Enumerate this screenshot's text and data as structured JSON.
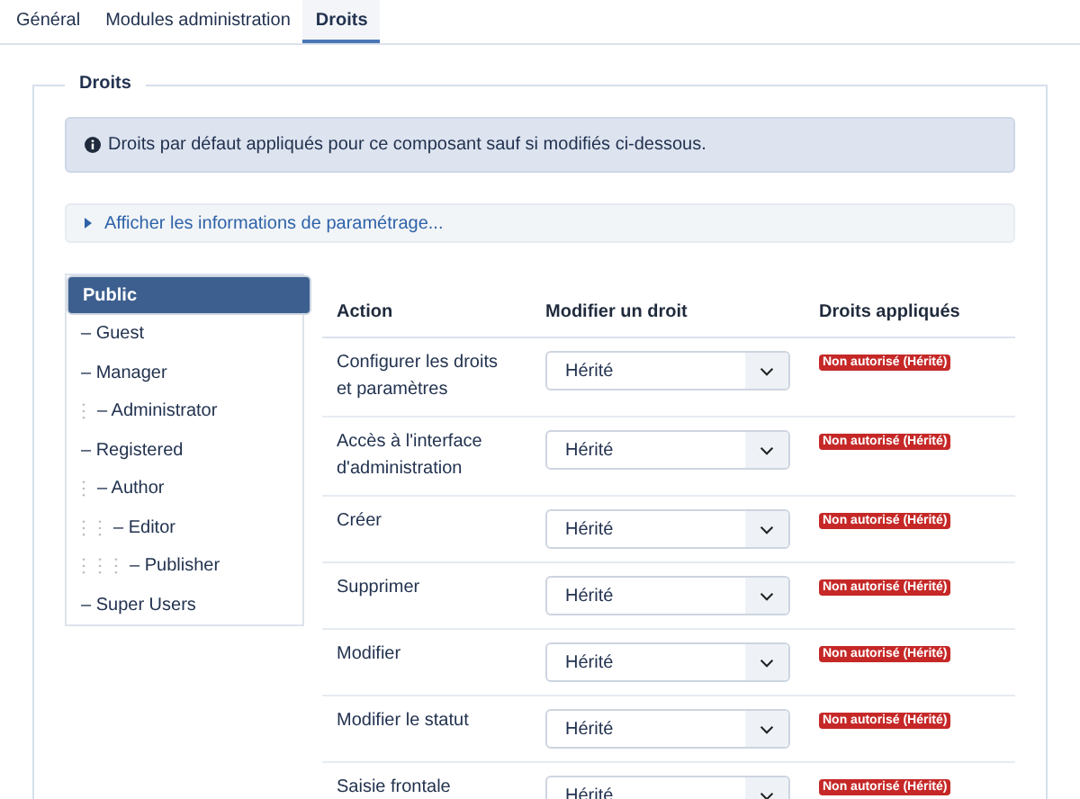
{
  "tabs": [
    {
      "label": "Général",
      "selected": false
    },
    {
      "label": "Modules administration",
      "selected": false
    },
    {
      "label": "Droits",
      "selected": true
    }
  ],
  "fieldset": {
    "legend": "Droits",
    "info": "Droits par défaut appliqués pour ce composant sauf si modifiés ci-dessous.",
    "details": {
      "label": "Afficher les informations de paramétrage...",
      "expanded": false
    },
    "groups": [
      {
        "label": "Public",
        "selected": true,
        "children": [
          {
            "label": "– Guest",
            "selected": false
          },
          {
            "label": "– Manager",
            "selected": false,
            "children": [
              {
                "label": "– Administrator",
                "selected": false
              }
            ]
          },
          {
            "label": "– Registered",
            "selected": false,
            "children": [
              {
                "label": "– Author",
                "selected": false,
                "children": [
                  {
                    "label": "– Editor",
                    "selected": false,
                    "children": [
                      {
                        "label": "– Publisher",
                        "selected": false
                      }
                    ]
                  }
                ]
              }
            ]
          },
          {
            "label": "– Super Users",
            "selected": false
          }
        ]
      }
    ],
    "table": {
      "columns": [
        "Action",
        "Modifier un droit",
        "Droits appliqués"
      ],
      "rows": [
        {
          "action": "Configurer les droits et paramètres",
          "setting": "Hérité",
          "applied": "Non autorisé (Hérité)"
        },
        {
          "action": "Accès à l'interface d'administration",
          "setting": "Hérité",
          "applied": "Non autorisé (Hérité)"
        },
        {
          "action": "Créer",
          "setting": "Hérité",
          "applied": "Non autorisé (Hérité)"
        },
        {
          "action": "Supprimer",
          "setting": "Hérité",
          "applied": "Non autorisé (Hérité)"
        },
        {
          "action": "Modifier",
          "setting": "Hérité",
          "applied": "Non autorisé (Hérité)"
        },
        {
          "action": "Modifier le statut",
          "setting": "Hérité",
          "applied": "Non autorisé (Hérité)"
        },
        {
          "action": "Saisie frontale",
          "setting": "Hérité",
          "applied": "Non autorisé (Hérité)"
        }
      ]
    }
  }
}
